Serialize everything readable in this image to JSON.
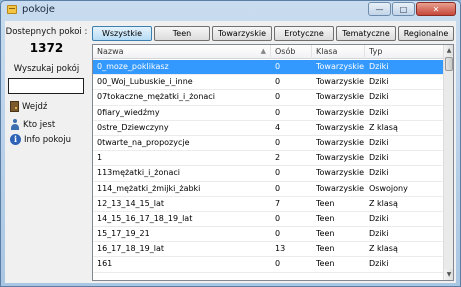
{
  "window": {
    "title": "pokoje",
    "minimize_glyph": "—",
    "maximize_glyph": "□",
    "close_glyph": "✕"
  },
  "left": {
    "rooms_label": "Dostepnych pokoi :",
    "rooms_count": "1372",
    "search_label": "Wyszukaj pokój",
    "search_value": "",
    "enter_label": "Wejdź",
    "who_label": "Kto jest",
    "info_label": "Info pokoju"
  },
  "tabs": [
    {
      "label": "Wszystkie",
      "active": true
    },
    {
      "label": "Teen",
      "active": false
    },
    {
      "label": "Towarzyskie",
      "active": false
    },
    {
      "label": "Erotyczne",
      "active": false
    },
    {
      "label": "Tematyczne",
      "active": false
    },
    {
      "label": "Regionalne",
      "active": false
    }
  ],
  "table": {
    "columns": [
      "Nazwa",
      "Osób",
      "Klasa",
      "Typ"
    ],
    "sort_glyph": "▲",
    "rows": [
      [
        "0_moze_poklikasz",
        "0",
        "Towarzyskie",
        "Dziki"
      ],
      [
        "00_Woj_Lubuskie_i_inne",
        "0",
        "Towarzyskie",
        "Dziki"
      ],
      [
        "07tokaczne_mężatki_i_żonaci",
        "0",
        "Towarzyskie",
        "Dziki"
      ],
      [
        "0fiary_wiedźmy",
        "0",
        "Towarzyskie",
        "Dziki"
      ],
      [
        "0stre_Dziewczyny",
        "4",
        "Towarzyskie",
        "Z klasą"
      ],
      [
        "0twarte_na_propozycje",
        "0",
        "Towarzyskie",
        "Dziki"
      ],
      [
        "1",
        "2",
        "Towarzyskie",
        "Dziki"
      ],
      [
        "113mężatki_i_żonaci",
        "0",
        "Towarzyskie",
        "Dziki"
      ],
      [
        "114_mężatki_żmijki_żabki",
        "0",
        "Towarzyskie",
        "Oswojony"
      ],
      [
        "12_13_14_15_lat",
        "7",
        "Teen",
        "Z klasą"
      ],
      [
        "14_15_16_17_18_19_lat",
        "0",
        "Teen",
        "Dziki"
      ],
      [
        "15_17_19_21",
        "0",
        "Teen",
        "Dziki"
      ],
      [
        "16_17_18_19_lat",
        "13",
        "Teen",
        "Z klasą"
      ],
      [
        "161",
        "0",
        "Teen",
        "Dziki"
      ]
    ]
  },
  "scroll": {
    "up_glyph": "▲",
    "down_glyph": "▼"
  }
}
